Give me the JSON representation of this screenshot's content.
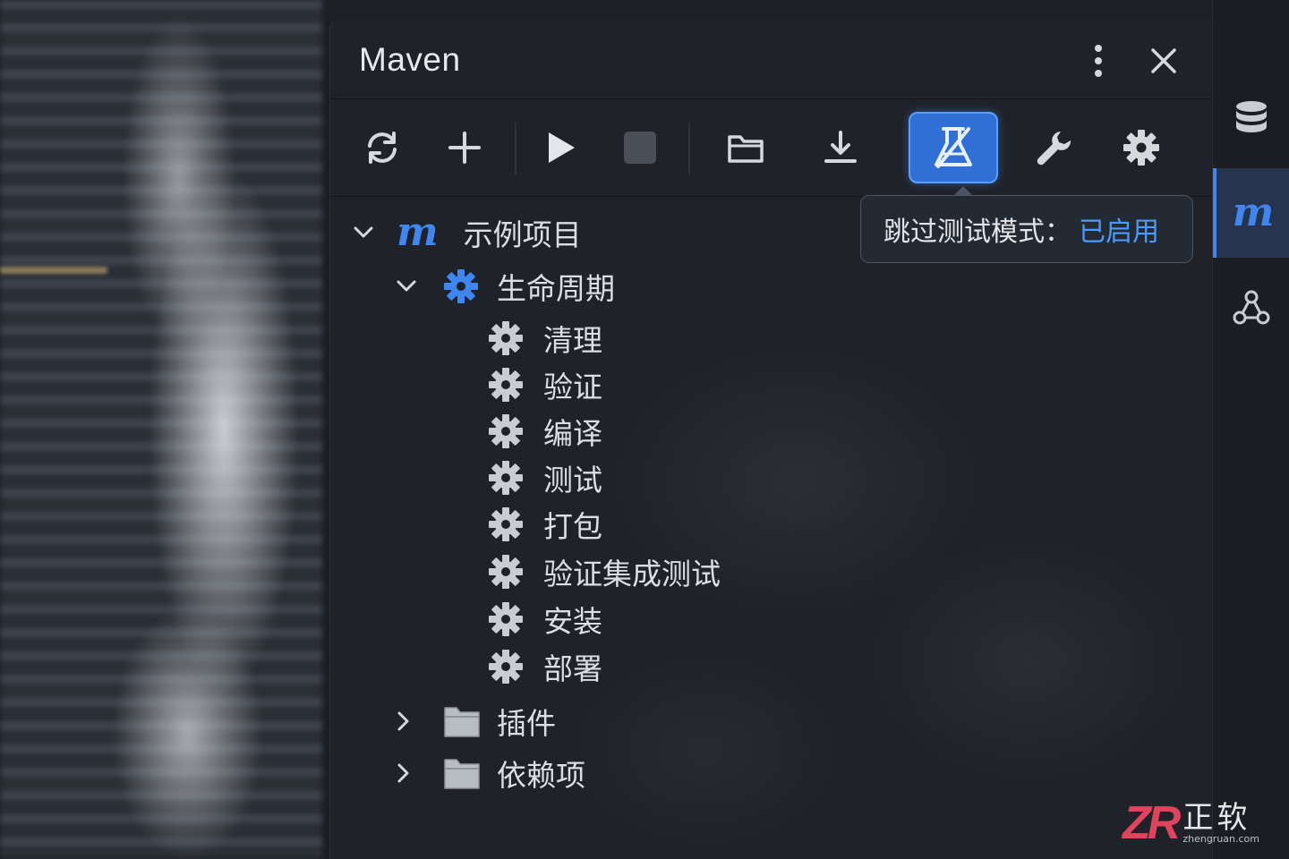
{
  "panel": {
    "title": "Maven",
    "more_options_icon": "vertical-ellipsis-icon",
    "close_icon": "close-icon"
  },
  "toolbar": {
    "buttons": [
      {
        "name": "reload-icon"
      },
      {
        "name": "add-icon"
      },
      {
        "name": "run-icon"
      },
      {
        "name": "stop-icon"
      },
      {
        "name": "folder-icon"
      },
      {
        "name": "download-icon"
      },
      {
        "name": "skip-tests-icon",
        "active": true
      },
      {
        "name": "wrench-icon"
      },
      {
        "name": "settings-icon"
      }
    ],
    "tooltip": {
      "text": "跳过测试模式：",
      "status": "已启用"
    }
  },
  "tree": {
    "project": {
      "label": "示例项目",
      "icon": "maven-m-icon"
    },
    "lifecycle": {
      "label": "生命周期",
      "phases": [
        "清理",
        "验证",
        "编译",
        "测试",
        "打包",
        "验证集成测试",
        "安装",
        "部署"
      ]
    },
    "plugins": {
      "label": "插件"
    },
    "dependencies": {
      "label": "依赖项"
    }
  },
  "right_sidebar": {
    "items": [
      {
        "name": "database-icon"
      },
      {
        "name": "maven-icon",
        "active": true
      },
      {
        "name": "structure-graph-icon"
      }
    ]
  },
  "watermark": {
    "logo": "ZR",
    "name": "正软",
    "url": "zhengruan.com"
  },
  "colors": {
    "accent": "#3f86f0",
    "tooltip_status": "#4a9bff",
    "panel_bg": "#1f2228",
    "active_button": "#2f6fd6"
  }
}
